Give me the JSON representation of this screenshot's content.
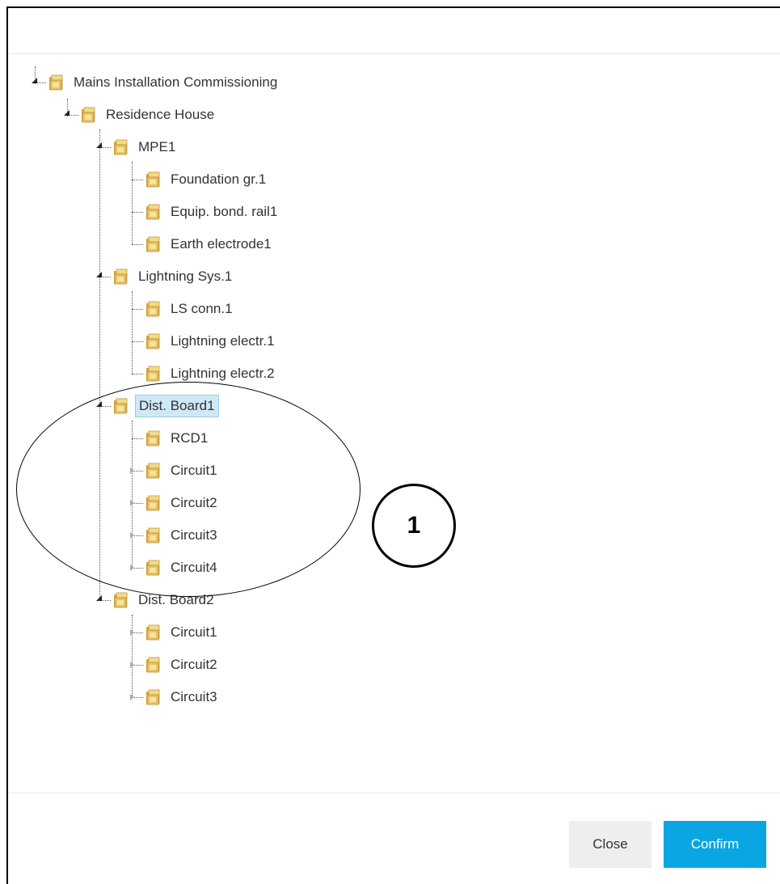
{
  "tree": {
    "nodes": [
      {
        "label": "Mains Installation Commissioning",
        "toggle": "expanded"
      },
      {
        "label": "Residence House",
        "toggle": "expanded"
      },
      {
        "label": "MPE1",
        "toggle": "expanded"
      },
      {
        "label": "Foundation gr.1",
        "toggle": "none"
      },
      {
        "label": "Equip. bond. rail1",
        "toggle": "none"
      },
      {
        "label": "Earth electrode1",
        "toggle": "none"
      },
      {
        "label": "Lightning Sys.1",
        "toggle": "expanded"
      },
      {
        "label": "LS conn.1",
        "toggle": "none"
      },
      {
        "label": "Lightning electr.1",
        "toggle": "none"
      },
      {
        "label": "Lightning electr.2",
        "toggle": "none"
      },
      {
        "label": "Dist. Board1",
        "toggle": "expanded",
        "selected": true
      },
      {
        "label": "RCD1",
        "toggle": "none"
      },
      {
        "label": "Circuit1",
        "toggle": "collapsed"
      },
      {
        "label": "Circuit2",
        "toggle": "collapsed"
      },
      {
        "label": "Circuit3",
        "toggle": "collapsed"
      },
      {
        "label": "Circuit4",
        "toggle": "collapsed"
      },
      {
        "label": "Dist. Board2",
        "toggle": "expanded"
      },
      {
        "label": "Circuit1",
        "toggle": "collapsed"
      },
      {
        "label": "Circuit2",
        "toggle": "collapsed"
      },
      {
        "label": "Circuit3",
        "toggle": "collapsed"
      }
    ]
  },
  "footer": {
    "close_label": "Close",
    "confirm_label": "Confirm"
  },
  "annotation": {
    "callout_number": "1"
  },
  "colors": {
    "confirm_bg": "#0aa6e3",
    "selected_bg": "#cfe8f5",
    "folder": "#e8c368"
  },
  "icons": {
    "folder": "folder-icon",
    "expanded": "expanded-triangle-icon",
    "collapsed": "collapsed-triangle-icon"
  }
}
